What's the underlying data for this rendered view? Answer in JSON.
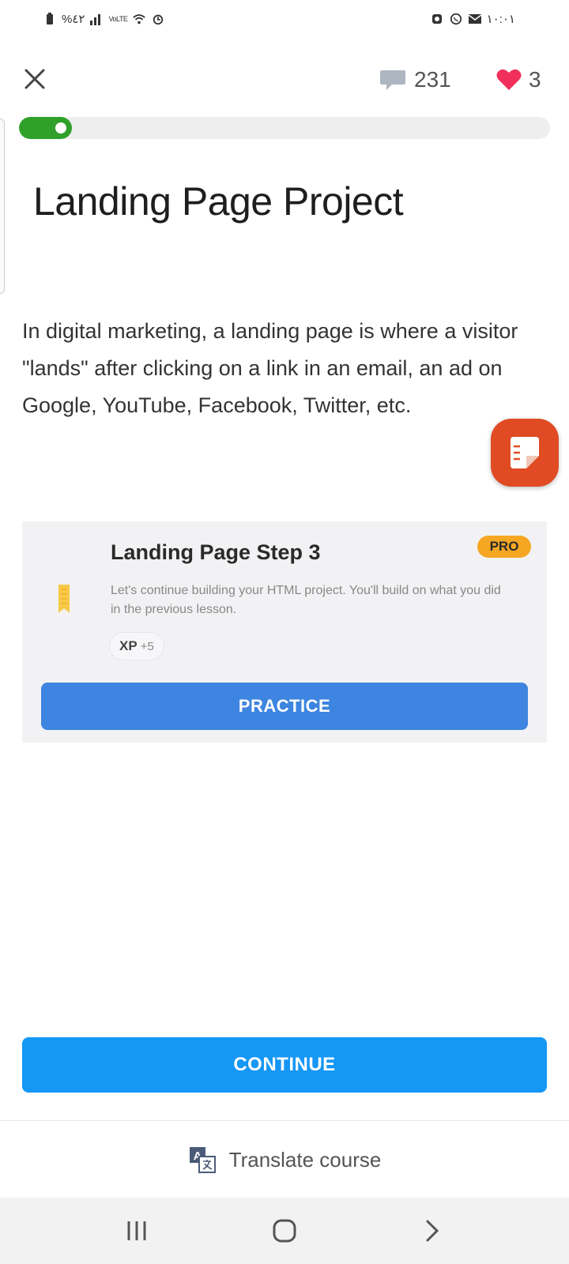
{
  "status_bar": {
    "left_text": "%٤٢",
    "network_text": "VoLTE",
    "time": "١٠:٠١"
  },
  "top_bar": {
    "comments_count": "231",
    "hearts_count": "3"
  },
  "progress": {
    "value": 0.1
  },
  "lesson": {
    "title": "Landing Page Project",
    "body": "In digital marketing, a landing page is where a visitor \"lands\" after clicking on a link in an email, an ad on Google, YouTube, Facebook, Twitter, etc."
  },
  "card": {
    "title": "Landing Page Step 3",
    "badge": "PRO",
    "description": "Let's continue building your HTML project. You'll build on what you did in the previous lesson.",
    "xp_label": "XP",
    "xp_value": "+5",
    "button_label": "PRACTICE"
  },
  "continue_label": "CONTINUE",
  "translate_label": "Translate course",
  "colors": {
    "progress": "#2fa12a",
    "practice": "#3d85e0",
    "continue": "#1597f5",
    "heart": "#f0305a",
    "pro_badge": "#f5a623"
  },
  "icons": {
    "close": "close-icon",
    "comments": "comment-icon",
    "hearts": "heart-icon",
    "float": "notes-icon",
    "ribbon": "bookmark-icon",
    "translate": "translate-icon",
    "nav_recent": "recents-icon",
    "nav_home": "home-icon",
    "nav_back": "back-icon"
  }
}
